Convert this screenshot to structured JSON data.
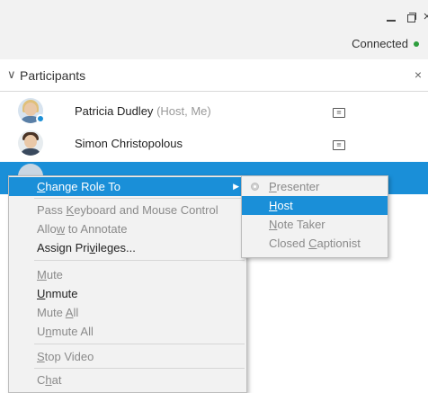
{
  "window": {
    "minimize_glyph": "",
    "close_glyph": "×",
    "status_text": "Connected",
    "status_color": "#2e9e3e"
  },
  "panel": {
    "chevron": "∨",
    "title": "Participants",
    "close_glyph": "×"
  },
  "participants": [
    {
      "name": "Patricia Dudley",
      "role": "(Host, Me)",
      "icon": "captioning-icon"
    },
    {
      "name": "Simon Christopolous",
      "role": "",
      "icon": "captioning-icon"
    }
  ],
  "context_menu": {
    "items": [
      {
        "pre": "",
        "u": "C",
        "post": "hange Role To",
        "state": "active",
        "submenu": true
      },
      {
        "pre": "Pass ",
        "u": "K",
        "post": "eyboard and Mouse Control",
        "state": "disabled"
      },
      {
        "pre": "Allo",
        "u": "w",
        "post": " to Annotate",
        "state": "disabled"
      },
      {
        "pre": "Assign Pri",
        "u": "v",
        "post": "ileges...",
        "state": "enabled"
      },
      {
        "pre": "",
        "u": "M",
        "post": "ute",
        "state": "disabled"
      },
      {
        "pre": "",
        "u": "U",
        "post": "nmute",
        "state": "enabled"
      },
      {
        "pre": "Mute ",
        "u": "A",
        "post": "ll",
        "state": "disabled"
      },
      {
        "pre": "U",
        "u": "n",
        "post": "mute All",
        "state": "disabled"
      },
      {
        "pre": "",
        "u": "S",
        "post": "top Video",
        "state": "disabled"
      },
      {
        "pre": "C",
        "u": "h",
        "post": "at",
        "state": "disabled"
      }
    ],
    "submenu_arrow": "▶"
  },
  "role_submenu": {
    "items": [
      {
        "pre": "",
        "u": "P",
        "post": "resenter",
        "state": "disabled",
        "selected": true
      },
      {
        "pre": "",
        "u": "H",
        "post": "ost",
        "state": "active"
      },
      {
        "pre": "",
        "u": "N",
        "post": "ote Taker",
        "state": "disabled"
      },
      {
        "pre": "Closed ",
        "u": "C",
        "post": "aptionist",
        "state": "disabled"
      }
    ]
  },
  "colors": {
    "accent": "#1a8fd8",
    "menu_bg": "#f2f2f2",
    "disabled_text": "#8a8a8a"
  }
}
